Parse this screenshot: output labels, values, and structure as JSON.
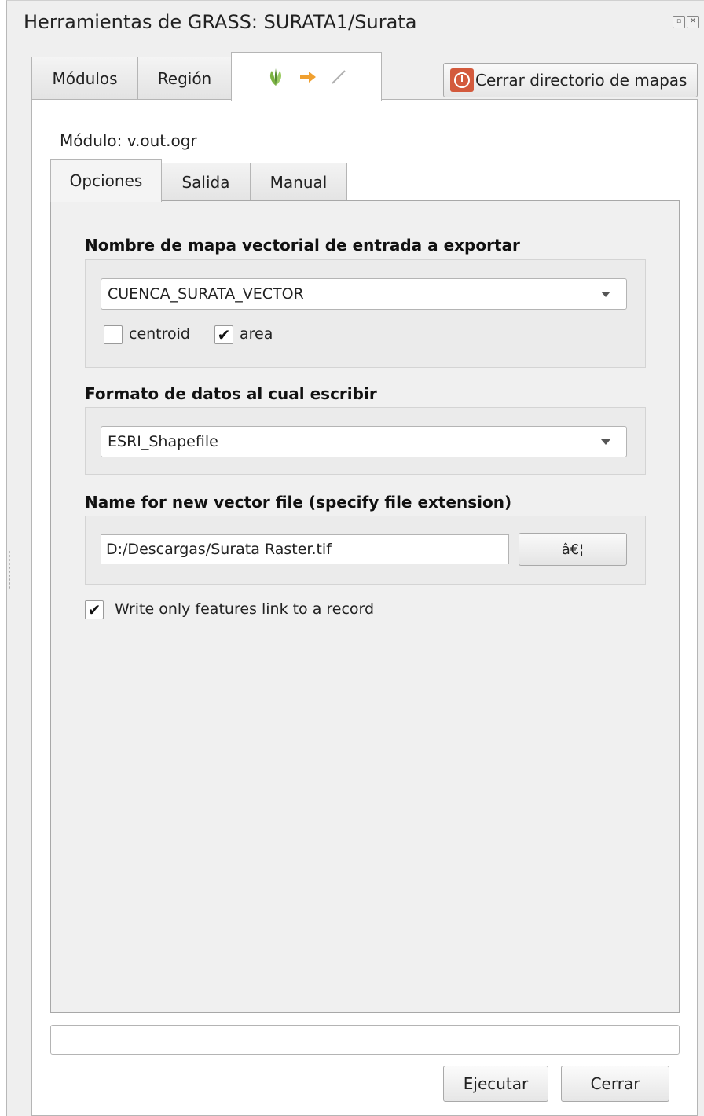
{
  "window": {
    "title": "Herramientas de GRASS: SURATA1/Surata"
  },
  "outer_tabs": [
    {
      "label": "Módulos"
    },
    {
      "label": "Región"
    },
    {
      "label": "",
      "icons": [
        "grass-leaf-icon",
        "arrow-right-icon",
        "line-vector-icon"
      ],
      "active": true
    }
  ],
  "close_mapset": {
    "label": "Cerrar directorio de mapas",
    "icon": "power-icon",
    "icon_color": "#d35a3d"
  },
  "module": {
    "label": "Módulo: v.out.ogr"
  },
  "inner_tabs": [
    {
      "label": "Opciones",
      "active": true
    },
    {
      "label": "Salida"
    },
    {
      "label": "Manual"
    }
  ],
  "options": {
    "input_map": {
      "label": "Nombre de mapa vectorial de entrada a exportar",
      "value": "CUENCA_SURATA_VECTOR",
      "types": [
        {
          "label": "centroid",
          "checked": false
        },
        {
          "label": "area",
          "checked": true
        }
      ]
    },
    "format": {
      "label": "Formato de datos al cual escribir",
      "value": "ESRI_Shapefile"
    },
    "output_file": {
      "label": "Name for new vector file (specify file extension)",
      "value": "D:/Descargas/Surata Raster.tif",
      "browse_label": "â€¦"
    },
    "write_linked": {
      "label": "Write only features link to a record",
      "checked": true
    }
  },
  "buttons": {
    "run": "Ejecutar",
    "close": "Cerrar"
  }
}
